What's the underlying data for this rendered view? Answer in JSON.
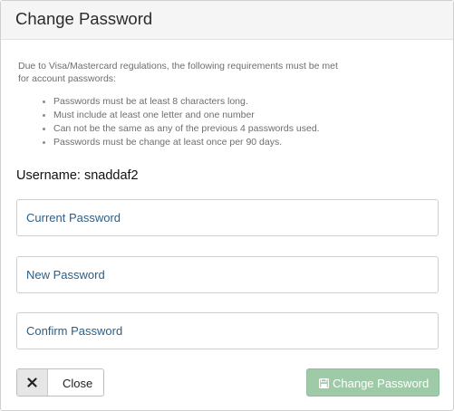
{
  "dialog": {
    "title": "Change Password",
    "intro": "Due to Visa/Mastercard regulations, the following requirements must be met for account passwords:",
    "requirements": [
      "Passwords must be at least 8 characters long.",
      "Must include at least one letter and one number",
      "Can not be the same as any of the previous 4 passwords used.",
      "Passwords must be change at least once per 90 days."
    ],
    "username_label": "Username:",
    "username_value": "snaddaf2"
  },
  "fields": {
    "current_password_placeholder": "Current Password",
    "new_password_placeholder": "New Password",
    "confirm_password_placeholder": "Confirm Password"
  },
  "buttons": {
    "close_label": "Close",
    "close_icon": "close-x-icon",
    "submit_label": "Change Password",
    "submit_icon": "save-floppy-icon"
  },
  "colors": {
    "header_bg": "#f5f5f5",
    "placeholder_text": "#2a5f8a",
    "submit_bg": "#9ecaa8"
  }
}
